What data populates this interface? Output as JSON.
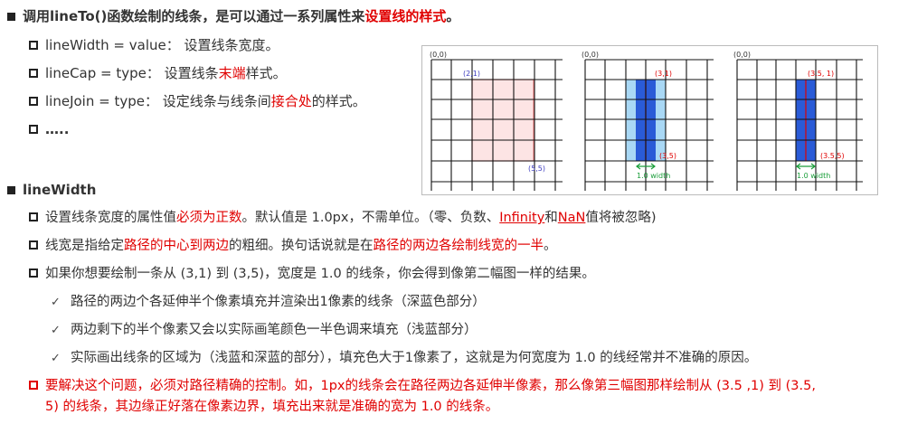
{
  "section1": {
    "title_prefix": "调用lineTo()函数绘制的线条，是可以通过一系列属性来",
    "title_red": "设置线的样式",
    "title_suffix": "。",
    "items": [
      {
        "text": "lineWidth = value：  设置线条宽度。"
      },
      {
        "prefix": "lineCap = type：  设置线条",
        "red": "末端",
        "suffix": "样式。"
      },
      {
        "prefix": "lineJoin = type：  设定线条与线条间",
        "red": "接合处",
        "suffix": "的样式。"
      },
      {
        "text": "….."
      }
    ]
  },
  "section2": {
    "title": "lineWidth",
    "p1": {
      "a": "设置线条宽度的属性值",
      "b": "必须为正数",
      "c": "。默认值是 1.0px，不需单位。（零、负数、",
      "d": "Infinity",
      "e": "和",
      "f": "NaN",
      "g": "值将被忽略)"
    },
    "p2": {
      "a": "线宽是指给定",
      "b": "路径的中心到两边",
      "c": "的粗细。换句话说就是在",
      "d": "路径的两边各绘制线宽的一半",
      "e": "。"
    },
    "p3": "如果你想要绘制一条从 (3,1) 到 (3,5)，宽度是 1.0 的线条，你会得到像第二幅图一样的结果。",
    "checks": [
      "路径的两边个各延伸半个像素填充并渲染出1像素的线条（深蓝色部分）",
      "两边剩下的半个像素又会以实际画笔颜色一半色调来填充（浅蓝部分）",
      "实际画出线条的区域为（浅蓝和深蓝的部分），填充色大于1像素了，这就是为何宽度为 1.0 的线经常并不准确的原因。"
    ],
    "p4_line1": "要解决这个问题，必须对路径精确的控制。如，1px的线条会在路径两边各延伸半像素，那么像第三幅图那样绘制从 (3.5 ,1) 到 (3.5,",
    "p4_line2": "5) 的线条，其边缘正好落在像素边界，填充出来就是准确的宽为 1.0 的线条。"
  },
  "figure": {
    "origin_label": "(0,0)",
    "g1": {
      "start": "(2,1)",
      "end": "(5,5)"
    },
    "g2": {
      "start": "(3,1)",
      "end": "(3,5)",
      "width": "1.0 width"
    },
    "g3": {
      "start": "(3.5, 1)",
      "end": "(3.5,5)",
      "width": "1.0 width"
    }
  },
  "colors": {
    "red": "#e00000",
    "light_red_fill": "#fde4e4",
    "light_blue": "#a9d8f5",
    "dark_blue": "#2a5bd7",
    "green": "#1a9e3a",
    "purple": "#4040c0"
  }
}
